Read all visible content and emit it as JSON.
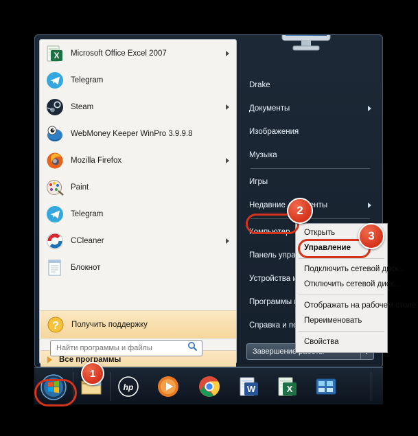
{
  "start_menu": {
    "programs": [
      {
        "label": "Microsoft Office Excel 2007",
        "icon": "excel-icon",
        "has_submenu": true
      },
      {
        "label": "Telegram",
        "icon": "telegram-icon",
        "has_submenu": false
      },
      {
        "label": "Steam",
        "icon": "steam-icon",
        "has_submenu": true
      },
      {
        "label": "WebMoney Keeper WinPro 3.9.9.8",
        "icon": "webmoney-icon",
        "has_submenu": false
      },
      {
        "label": "Mozilla Firefox",
        "icon": "firefox-icon",
        "has_submenu": true
      },
      {
        "label": "Paint",
        "icon": "paint-icon",
        "has_submenu": false
      },
      {
        "label": "Telegram",
        "icon": "telegram-icon",
        "has_submenu": false
      },
      {
        "label": "CCleaner",
        "icon": "ccleaner-icon",
        "has_submenu": true
      },
      {
        "label": "Блокнот",
        "icon": "notepad-icon",
        "has_submenu": false
      }
    ],
    "help_item": {
      "label": "Получить поддержку",
      "icon": "help-question-icon"
    },
    "all_programs": {
      "label": "Все программы",
      "icon": "green-triangle-icon"
    },
    "search": {
      "placeholder": "Найти программы и файлы",
      "value": "",
      "icon": "search-icon"
    },
    "right_items": [
      {
        "label": "Drake",
        "has_submenu": false
      },
      {
        "label": "Документы",
        "has_submenu": true
      },
      {
        "label": "Изображения",
        "has_submenu": false
      },
      {
        "label": "Музыка",
        "has_submenu": false
      },
      {
        "label": "Игры",
        "has_submenu": false
      },
      {
        "label": "Недавние документы",
        "has_submenu": true
      },
      {
        "label": "Компьютер",
        "has_submenu": false
      },
      {
        "label": "Панель управления",
        "has_submenu": true
      },
      {
        "label": "Устройства и принтеры",
        "has_submenu": false
      },
      {
        "label": "Программы по умолчанию",
        "has_submenu": false
      },
      {
        "label": "Справка и поддержка",
        "has_submenu": false
      }
    ],
    "shutdown": {
      "label": "Завершение работы",
      "arrow_icon": "chevron-right-icon"
    }
  },
  "context_menu": {
    "items": [
      {
        "label": "Открыть",
        "bold": false,
        "separator_after": false
      },
      {
        "label": "Управление",
        "bold": true,
        "separator_after": true
      },
      {
        "label": "Подключить сетевой диск...",
        "bold": false,
        "separator_after": false
      },
      {
        "label": "Отключить сетевой диск...",
        "bold": false,
        "separator_after": true
      },
      {
        "label": "Отображать на рабочем столе",
        "bold": false,
        "separator_after": false
      },
      {
        "label": "Переименовать",
        "bold": false,
        "separator_after": true
      },
      {
        "label": "Свойства",
        "bold": false,
        "separator_after": false
      }
    ]
  },
  "taskbar": {
    "items": [
      {
        "name": "start-orb",
        "icon": "windows-orb-icon"
      },
      {
        "name": "explorer",
        "icon": "folder-icon"
      },
      {
        "name": "hp-app",
        "icon": "hp-icon"
      },
      {
        "name": "media-player",
        "icon": "media-player-icon"
      },
      {
        "name": "chrome",
        "icon": "chrome-icon"
      },
      {
        "name": "word",
        "icon": "word-icon"
      },
      {
        "name": "excel",
        "icon": "excel-icon"
      },
      {
        "name": "control-panel",
        "icon": "control-panel-icon"
      }
    ]
  },
  "annotations": {
    "badges": [
      {
        "number": "1",
        "target": "start-orb"
      },
      {
        "number": "2",
        "target": "computer-menu-item"
      },
      {
        "number": "3",
        "target": "manage-context-item"
      }
    ]
  },
  "colors": {
    "accent_red": "#d6331b",
    "menu_bg": "#f4f3f0",
    "highlight": "#fbe7c2"
  }
}
